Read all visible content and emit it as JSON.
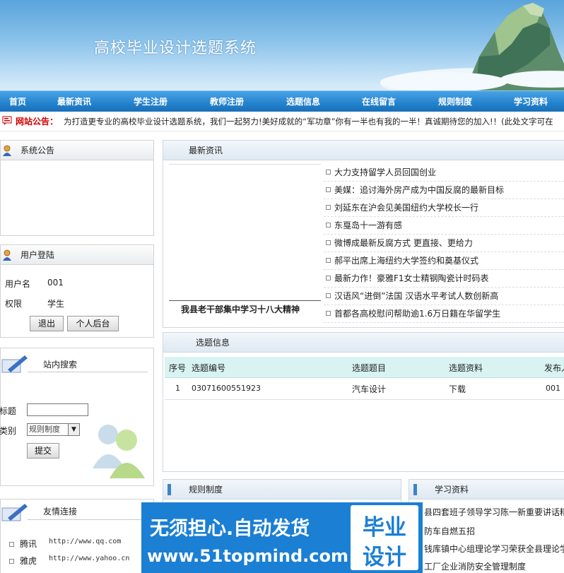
{
  "header": {
    "title": "高校毕业设计选题系统"
  },
  "nav": [
    "首页",
    "最新资讯",
    "学生注册",
    "教师注册",
    "选题信息",
    "在线留言",
    "规则制度",
    "学习资料"
  ],
  "notice": {
    "label": "网站公告：",
    "text": "为打造更专业的高校毕业设计选题系统，我们一起努力!美好成就的“军功章”你有一半也有我的一半！真诚期待您的加入!！(此处文字可在"
  },
  "system_notice": {
    "title": "系统公告"
  },
  "login": {
    "title": "用户登陆",
    "username_label": "用户名",
    "username_value": "001",
    "role_label": "权限",
    "role_value": "学生",
    "logout": "退出",
    "backend": "个人后台"
  },
  "search": {
    "title": "站内搜索",
    "title_label": "标题",
    "category_label": "类别",
    "category_value": "规则制度",
    "submit": "提交"
  },
  "links": {
    "title": "友情连接",
    "items": [
      {
        "name": "腾讯",
        "url": "http://www.qq.com"
      },
      {
        "name": "雅虎",
        "url": "http://www.yahoo.cn"
      }
    ]
  },
  "news": {
    "title": "最新资讯",
    "caption": "我县老干部集中学习十八大精神",
    "items": [
      "大力支持留学人员回国创业",
      "美媒：追讨海外房产成为中国反腐的最新目标",
      "刘延东在沪会见美国纽约大学校长一行",
      "东戛岛十一游有感",
      "微博成最新反腐方式 更直接、更给力",
      "郝平出席上海纽约大学签约和奠基仪式",
      "最新力作！豪雅F1女士精钢陶瓷计时码表",
      "汉语风“进倒”法国 汉语水平考试人数创新高",
      "首都各高校慰问帮助逾1.6万日籍在华留学生"
    ]
  },
  "topics": {
    "title": "选题信息",
    "columns": [
      "序号",
      "选题编号",
      "选题题目",
      "选题资料",
      "发布人"
    ],
    "rows": [
      [
        "1",
        "03071600551923",
        "汽车设计",
        "下载",
        "001"
      ]
    ]
  },
  "rules": {
    "title": "规则制度"
  },
  "study": {
    "title": "学习资料",
    "items": [
      "县四套班子领导学习陈一新重要讲话精神",
      "防车自燃五招",
      "钱库镇中心组理论学习荣获全县理论学习",
      "工厂企业消防安全管理制度"
    ]
  },
  "watermark": {
    "line1": "无须担心.自动发货",
    "line2": "www.51topmind.com",
    "badge1": "毕业",
    "badge2": "设计"
  },
  "colors": {
    "nav": "#2585d0",
    "notice_label": "#d20000",
    "table_head": "#d8f3f2",
    "watermark": "#1b7fd4"
  }
}
